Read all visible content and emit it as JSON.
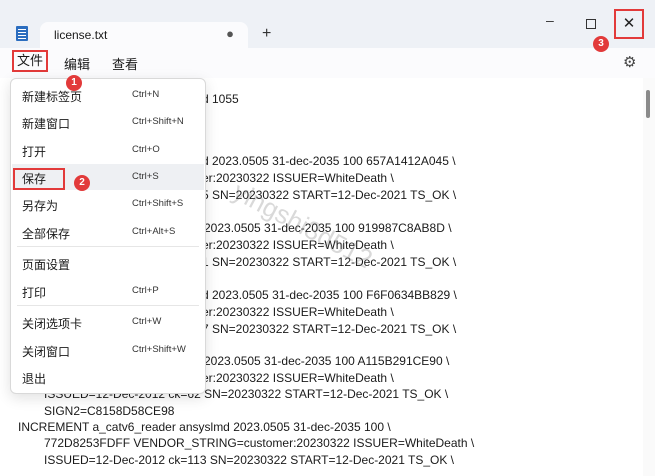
{
  "window": {
    "tab_title": "license.txt",
    "tab_unsaved_marker": "●",
    "new_tab_label": "+",
    "minimize_label": "–",
    "close_label": "✕"
  },
  "menubar": {
    "file": "文件",
    "edit": "编辑",
    "view": "查看",
    "settings_icon": "gear-icon"
  },
  "file_menu": {
    "items": [
      {
        "label": "新建标签页",
        "shortcut": "Ctrl+N"
      },
      {
        "label": "新建窗口",
        "shortcut": "Ctrl+Shift+N"
      },
      {
        "label": "打开",
        "shortcut": "Ctrl+O"
      },
      {
        "label": "保存",
        "shortcut": "Ctrl+S"
      },
      {
        "label": "另存为",
        "shortcut": "Ctrl+Shift+S"
      },
      {
        "label": "全部保存",
        "shortcut": "Ctrl+Alt+S"
      },
      {
        "label": "页面设置",
        "shortcut": ""
      },
      {
        "label": "打印",
        "shortcut": "Ctrl+P"
      },
      {
        "label": "关闭选项卡",
        "shortcut": "Ctrl+W"
      },
      {
        "label": "关闭窗口",
        "shortcut": "Ctrl+Shift+W"
      },
      {
        "label": "退出",
        "shortcut": ""
      }
    ]
  },
  "annotations": {
    "step1": "1",
    "step2": "2",
    "step3": "3"
  },
  "editor": {
    "lines": [
      "d 1055",
      "d 2023.0505 31-dec-2035 100 657A1412A045 \\",
      "er:20230322 ISSUER=WhiteDeath \\",
      "5 SN=20230322 START=12-Dec-2021 TS_OK \\",
      "2023.0505 31-dec-2035 100 919987C8AB8D \\",
      "er:20230322 ISSUER=WhiteDeath \\",
      "1 SN=20230322 START=12-Dec-2021 TS_OK \\",
      "d 2023.0505 31-dec-2035 100 F6F0634BB829 \\",
      "er:20230322 ISSUER=WhiteDeath \\",
      "7 SN=20230322 START=12-Dec-2021 TS_OK \\",
      "2023.0505 31-dec-2035 100 A115B291CE90 \\",
      "er:20230322 ISSUER=WhiteDeath \\",
      "ISSUED=12-Dec-2012 ck=62 SN=20230322 START=12-Dec-2021 TS_OK \\",
      "SIGN2=C8158D58CE98",
      "INCREMENT a_catv6_reader ansyslmd 2023.0505 31-dec-2035 100 \\",
      "772D8253FDFF VENDOR_STRING=customer:20230322 ISSUER=WhiteDeath \\",
      "ISSUED=12-Dec-2012 ck=113 SN=20230322 START=12-Dec-2021 TS_OK \\"
    ]
  },
  "watermark": "yingshi3d512"
}
